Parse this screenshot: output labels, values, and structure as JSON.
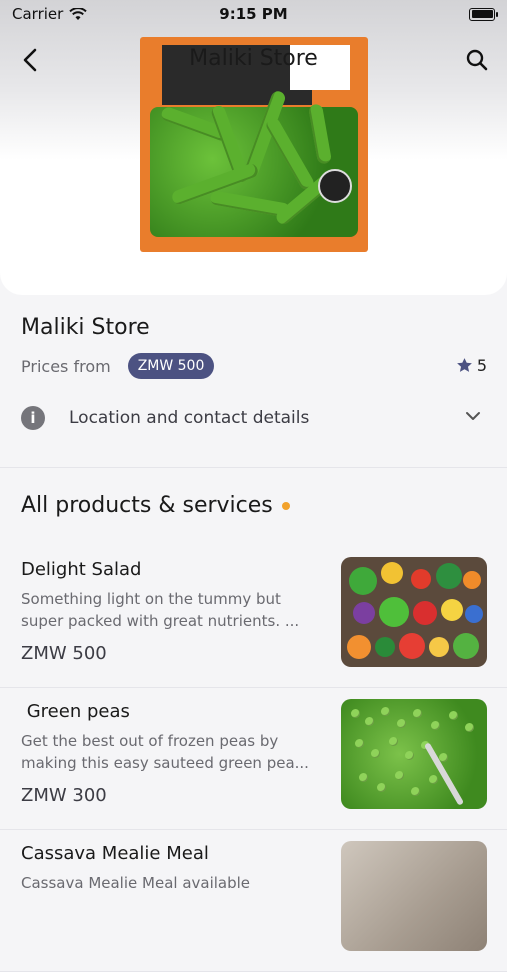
{
  "status_bar": {
    "carrier": "Carrier",
    "time": "9:15 PM"
  },
  "nav": {
    "title": "Maliki Store"
  },
  "store": {
    "name": "Maliki Store",
    "prices_from_label": "Prices from",
    "price_badge": "ZMW 500",
    "rating": "5",
    "location_label": "Location and contact details"
  },
  "section": {
    "heading": "All products & services"
  },
  "products": [
    {
      "name": "Delight Salad",
      "description": "Something light on the tummy but super packed with great nutrients. ...",
      "price": "ZMW 500"
    },
    {
      "name": " Green peas",
      "description": "Get the best out of frozen peas by making this easy sauteed green pea...",
      "price": "ZMW 300"
    },
    {
      "name": "Cassava Mealie Meal",
      "description": "Cassava Mealie Meal available"
    }
  ],
  "colors": {
    "badge": "#4c5282",
    "accent_dot": "#f2a22c",
    "background": "#f5f5f7"
  },
  "icons": [
    "back-chevron-icon",
    "search-icon",
    "star-icon",
    "info-icon",
    "chevron-down-icon",
    "wifi-icon",
    "battery-icon"
  ]
}
